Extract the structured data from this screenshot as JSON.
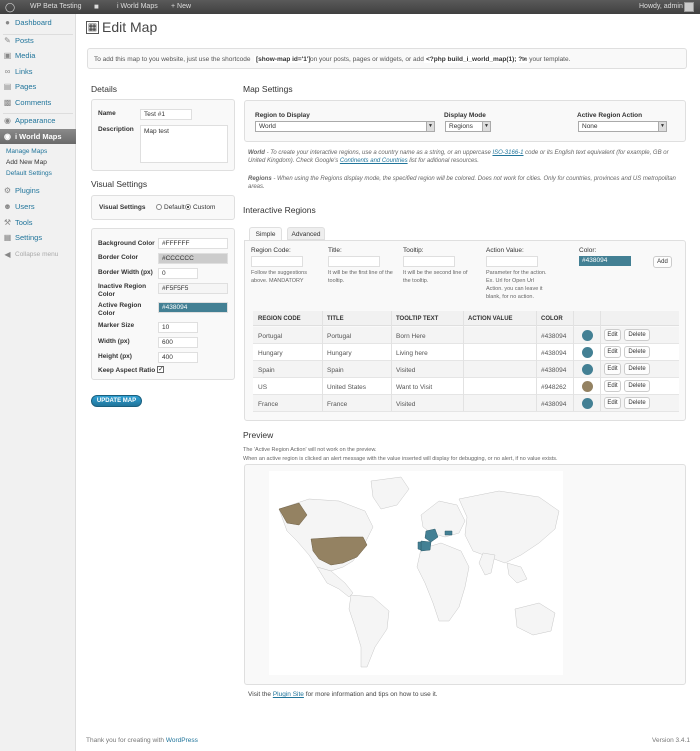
{
  "adminbar": {
    "site_name": "WP Beta Testing",
    "plugin_name": "i World Maps",
    "new_label": "New",
    "howdy": "Howdy, admin"
  },
  "menu": {
    "dashboard": "Dashboard",
    "posts": "Posts",
    "media": "Media",
    "links": "Links",
    "pages": "Pages",
    "comments": "Comments",
    "appearance": "Appearance",
    "iworldmaps": "i World Maps",
    "submenu": [
      "Manage Maps",
      "Add New Map",
      "Default Settings"
    ],
    "plugins": "Plugins",
    "users": "Users",
    "tools": "Tools",
    "settings": "Settings",
    "collapse": "Collapse menu"
  },
  "page": {
    "title": "Edit Map",
    "info_prefix": "To add this map to you website, just use the shortcode",
    "shortcode": "[show-map id='1']",
    "info_mid": "on your posts, pages or widgets, or add",
    "php": "<?php build_i_world_map(1); ?>",
    "info_suffix": "to your template."
  },
  "details": {
    "heading": "Details",
    "name_label": "Name",
    "name_value": "Test #1",
    "desc_label": "Description",
    "desc_value": "Map test"
  },
  "visual": {
    "heading": "Visual Settings",
    "label": "Visual Settings",
    "opt_default": "Default",
    "opt_custom": "Custom",
    "bg_label": "Background Color",
    "bg_value": "#FFFFFF",
    "border_label": "Border Color",
    "border_value": "#CCCCCC",
    "bw_label": "Border Width (px)",
    "bw_value": "0",
    "inactive_label": "Inactive Region Color",
    "inactive_value": "#F5F5F5",
    "active_label": "Active Region Color",
    "active_value": "#438094",
    "marker_label": "Marker Size",
    "marker_value": "10",
    "width_label": "Width (px)",
    "width_value": "600",
    "height_label": "Height (px)",
    "height_value": "400",
    "ratio_label": "Keep Aspect Ratio",
    "update_button": "UPDATE MAP"
  },
  "map_settings": {
    "heading": "Map Settings",
    "region_label": "Region to Display",
    "region_value": "World",
    "mode_label": "Display Mode",
    "mode_value": "Regions",
    "action_label": "Active Region Action",
    "action_value": "None",
    "world_note_title": "World",
    "world_note_1": "- To create your interactive regions, use a country name as a string, or an uppercase",
    "world_note_link1": "ISO-3166-1",
    "world_note_2": "code or its English text equivalent (for example, GB or United Kingdom). Check Google's",
    "world_note_link2": "Continents and Countries",
    "world_note_3": "list for aditional resources.",
    "regions_note_title": "Regions",
    "regions_note": "- When using the Regions display mode, the specified region will be colored. Does not work for cities. Only for countries, provinces and US metropolitan areas."
  },
  "regions": {
    "heading": "Interactive Regions",
    "tab_simple": "Simple",
    "tab_advanced": "Advanced",
    "code_label": "Region Code:",
    "code_hint": "Follow the suggestions above. MANDATORY",
    "title_label": "Title:",
    "title_hint": "It will be the first line of the tooltip.",
    "tooltip_label": "Tooltip:",
    "tooltip_hint": "It will be the second line of the tooltip.",
    "action_label": "Action Value:",
    "action_hint": "Parameter for the action. Ex. Url for Open Url Action. you can leave it blank, for no action.",
    "color_label": "Color:",
    "color_value": "#438094",
    "add_button": "Add",
    "columns": [
      "REGION CODE",
      "TITLE",
      "TOOLTIP TEXT",
      "ACTION VALUE",
      "COLOR"
    ],
    "rows": [
      {
        "code": "Portugal",
        "title": "Portugal",
        "tooltip": "Born Here",
        "action": "",
        "color": "#438094"
      },
      {
        "code": "Hungary",
        "title": "Hungary",
        "tooltip": "Living here",
        "action": "",
        "color": "#438094"
      },
      {
        "code": "Spain",
        "title": "Spain",
        "tooltip": "Visited",
        "action": "",
        "color": "#438094"
      },
      {
        "code": "US",
        "title": "United States",
        "tooltip": "Want to Visit",
        "action": "",
        "color": "#948262"
      },
      {
        "code": "France",
        "title": "France",
        "tooltip": "Visited",
        "action": "",
        "color": "#438094"
      }
    ],
    "edit_label": "Edit",
    "delete_label": "Delete"
  },
  "preview": {
    "heading": "Preview",
    "note1": "The 'Active Region Action' will not work on the preview.",
    "note2": "When an active region is clicked an alert message with the value inserted will display for debugging, or no alert, if no value exists.",
    "visit_prefix": "Visit the",
    "visit_link": "Plugin Site",
    "visit_suffix": "for more information and tips on how to use it."
  },
  "footer": {
    "thanks_prefix": "Thank you for creating with",
    "thanks_link": "WordPress",
    "version": "Version 3.4.1"
  }
}
